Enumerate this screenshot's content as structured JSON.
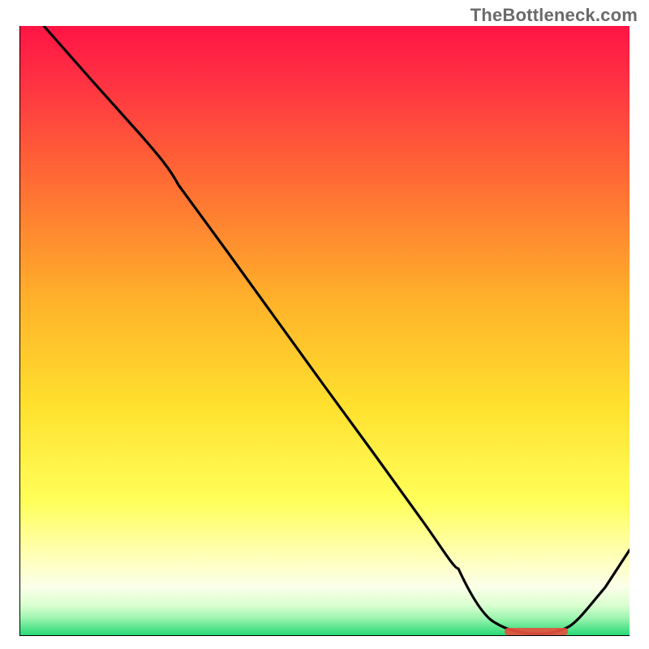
{
  "watermark": "TheBottleneck.com",
  "chart_data": {
    "type": "line",
    "title": "",
    "xlabel": "",
    "ylabel": "",
    "xlim": [
      0,
      100
    ],
    "ylim": [
      0,
      100
    ],
    "grid": false,
    "background_gradient": {
      "top": "#ff1848",
      "mid_upper": "#ffb42b",
      "mid_lower": "#ffff60",
      "pale_band": "#ffffd0",
      "bottom": "#2fe07a"
    },
    "x": [
      4,
      12,
      20,
      26,
      34,
      42,
      50,
      58,
      66,
      72,
      78,
      84,
      88,
      92,
      96,
      100
    ],
    "values": [
      100,
      91,
      82,
      74,
      63,
      52,
      41,
      30,
      19,
      11,
      4,
      0.5,
      0.3,
      3,
      8,
      14
    ],
    "marker": {
      "present": true,
      "color": "#e74a3d",
      "x_range": [
        80,
        90
      ],
      "y": 0.3,
      "shape": "segment"
    },
    "notes": "No axis tick labels are visible in the source image; values above are estimated from pixel positions relative to the plot extents."
  }
}
